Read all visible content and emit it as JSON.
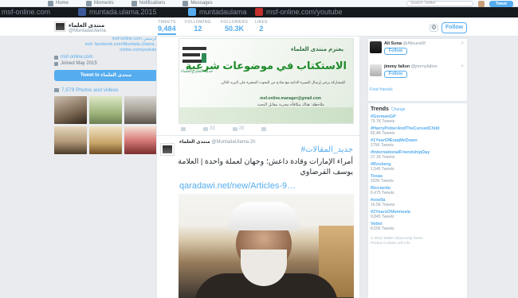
{
  "topnav": {
    "items": [
      {
        "label": "Home",
        "icon": "home-icon"
      },
      {
        "label": "Moments",
        "icon": "lightning-icon"
      },
      {
        "label": "Notifications",
        "icon": "bell-icon"
      },
      {
        "label": "Messages",
        "icon": "envelope-icon"
      }
    ],
    "search_placeholder": "Search Twitter",
    "tweet_button": "Tweet"
  },
  "banner": {
    "segments": [
      "msf-online.com",
      "muntada.ulama.2015",
      "muntadaulama",
      "msf-online.com/youtube"
    ]
  },
  "profile": {
    "name": "منتدى العلماء",
    "handle": "@MuntadaUlama",
    "bio_lines": [
      "msf-online.com الرسمي",
      "msf- facebook.com/Muntada.Ulama...",
      "online.com/youtube"
    ],
    "website": "msf-online.com",
    "joined": "Joined May 2015",
    "tweet_to_label": "Tweet to منتدى العلماء",
    "photos_label": "7,579 Photos and videos"
  },
  "stats": [
    {
      "label": "TWEETS",
      "value": "9,484",
      "active": true
    },
    {
      "label": "FOLLOWING",
      "value": "12",
      "active": false
    },
    {
      "label": "FOLLOWERS",
      "value": "50.3K",
      "active": false
    },
    {
      "label": "LIKES",
      "value": "2",
      "active": false
    }
  ],
  "follow_label": "Follow",
  "tweet1": {
    "image": {
      "logo_text": "منتدى العلماء",
      "logo_sub": "خدمة العلم والعلماء",
      "tagline": "يعتزم منتدى العلماء",
      "headline": "الاستكتاب في موضوعات شرعية",
      "body": "للمشاركة يرجى إرسال السيرة الذاتية مع نماذج من البحوث المنجزة على البريد التالي",
      "email": "msf.online.manager@gmail.com",
      "note": "ملاحظة: هناك مكافأة مجزية مقابل البحث"
    },
    "actions": {
      "retweets": "33",
      "likes": "29"
    }
  },
  "tweet2": {
    "name": "منتدى العلماء",
    "handle": "@MuntadaUlama",
    "time": "2h",
    "hashtag": "#جديد_المقالات",
    "text": "أمراء الإمارات وقادة داعش؛ وجهان لعملة واحدة | العلامة يوسف القرضاوي",
    "link": "qaradawi.net/new/Articles-9…"
  },
  "who_to_follow": [
    {
      "name": "Ali Suna",
      "handle": "@Alisuna0f",
      "follow": "Follow"
    },
    {
      "name": "jimmy fallon",
      "handle": "@jimmyfallon",
      "follow": "Follow"
    }
  ],
  "find_friends": "Find friends",
  "trends": {
    "title": "Trends",
    "change": "Change",
    "items": [
      {
        "name": "#GermanGP",
        "count": "79.7K Tweets"
      },
      {
        "name": "#HarryPotterAndTheCursedChild",
        "count": "82.4K Tweets"
      },
      {
        "name": "#1YearOfEraqMeDown",
        "count": "175K Tweets"
      },
      {
        "name": "#InternationalFriendshipDay",
        "count": "27.1K Tweets"
      },
      {
        "name": "#Rosberg",
        "count": "1,546 Tweets"
      },
      {
        "name": "Texas",
        "count": "322K Tweets"
      },
      {
        "name": "Ricciardo",
        "count": "6,475 Tweets"
      },
      {
        "name": "#zoella",
        "count": "16.5K Tweets"
      },
      {
        "name": "#2YearsOfAmnesia",
        "count": "9,845 Tweets"
      },
      {
        "name": "Vettel",
        "count": "8,556 Tweets"
      }
    ],
    "footer": [
      "© 2016 Twitter  About  Help  Terms",
      "Privacy  Cookies  Ads info"
    ]
  }
}
